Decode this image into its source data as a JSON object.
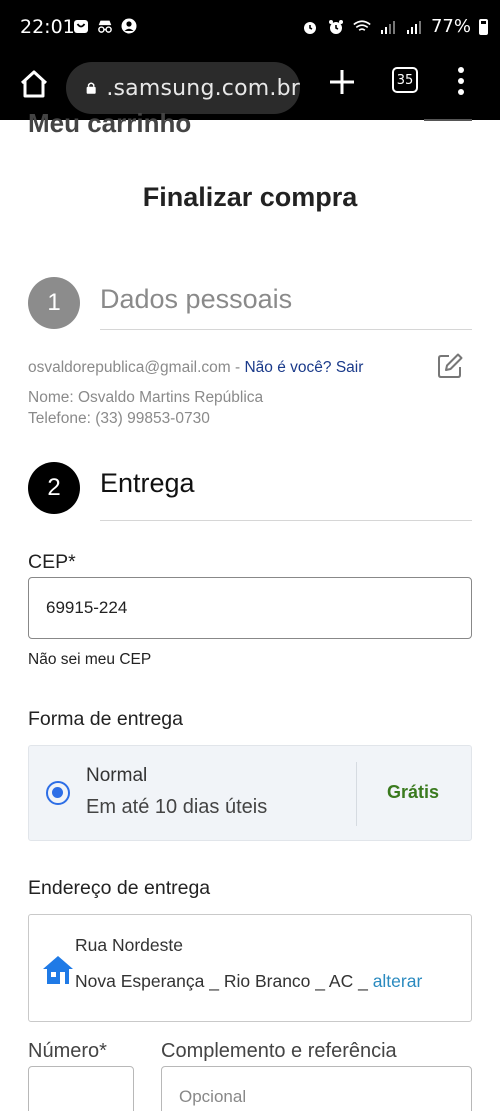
{
  "status_bar": {
    "time": "22:01",
    "battery_pct": "77%"
  },
  "browser": {
    "url": ".samsung.com.br",
    "tab_count": "35"
  },
  "page": {
    "cut_header": "Meu carrinho",
    "title": "Finalizar compra"
  },
  "step1": {
    "number": "1",
    "title": "Dados pessoais",
    "email": "osvaldorepublica@gmail.com",
    "separator": " - ",
    "not_you_link": "Não é você? Sair",
    "name": "Nome: Osvaldo Martins República",
    "phone": "Telefone: (33) 99853-0730"
  },
  "step2": {
    "number": "2",
    "title": "Entrega",
    "cep_label": "CEP*",
    "cep_value": "69915-224",
    "cep_help_link": "Não sei meu CEP",
    "shipping_label": "Forma de entrega",
    "shipping_option": {
      "name": "Normal",
      "eta": "Em até 10 dias úteis",
      "price": "Grátis",
      "selected": true
    },
    "address_label": "Endereço de entrega",
    "address": {
      "street": "Rua Nordeste",
      "line2": "Nova Esperança _ Rio Branco _ AC _",
      "change_link": "alterar"
    },
    "number_label": "Número*",
    "complement_label": "Complemento e referência",
    "complement_placeholder": "Opcional"
  },
  "colors": {
    "accent_blue": "#2d6ee6",
    "link_blue": "#1a3a8a",
    "free_green": "#3a7a1e"
  }
}
